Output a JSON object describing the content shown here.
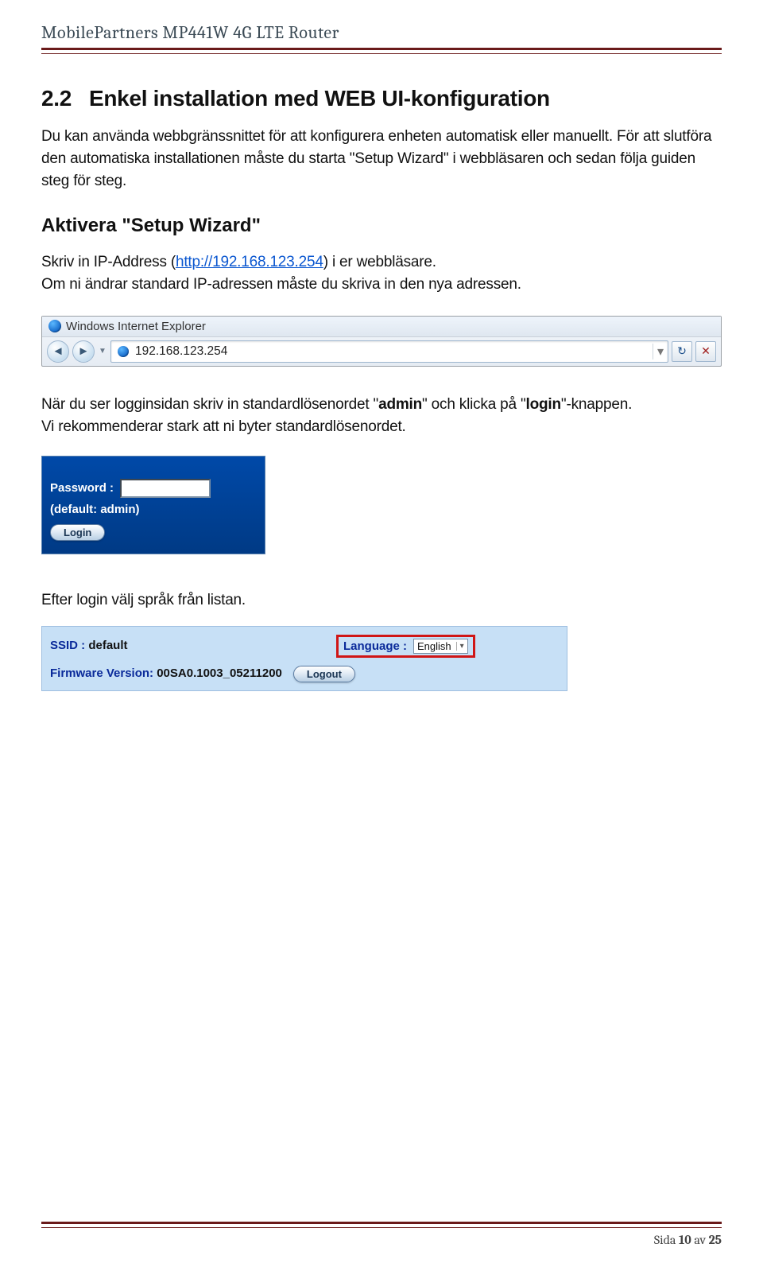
{
  "doc": {
    "header_title": "MobilePartners MP441W 4G LTE Router",
    "section_number": "2.2",
    "section_title": "Enkel installation med WEB UI-konfiguration",
    "para1": "Du kan använda webbgränssnittet för att konfigurera enheten automatisk eller manuellt. För att slutföra den automatiska installationen måste du starta \"Setup Wizard\" i webbläsaren och sedan följa guiden steg för steg.",
    "sub1": "Aktivera \"Setup Wizard\"",
    "ip_pre": "Skriv in IP-Address (",
    "ip_link_text": "http://192.168.123.254",
    "ip_post": ") i er webbläsare.",
    "ip_note": "Om ni ändrar standard IP-adressen måste du skriva in den nya adressen.",
    "para_login_a": "När du ser logginsidan skriv in standardlösenordet \"",
    "para_login_admin": "admin",
    "para_login_b": "\" och klicka på \"",
    "para_login_login": "login",
    "para_login_c": "\"-knappen.",
    "para_login_rec": "Vi rekommenderar stark att ni byter standardlösenordet.",
    "after_login": "Efter login välj språk från listan.",
    "footer_prefix": "Sida ",
    "footer_num": "10",
    "footer_mid": " av ",
    "footer_total": "25"
  },
  "ie": {
    "title": "Windows Internet Explorer",
    "url": "192.168.123.254"
  },
  "login": {
    "password_label": "Password :",
    "default_hint": "(default: admin)",
    "login_btn": "Login",
    "password_value": ""
  },
  "lang": {
    "ssid_label": "SSID : ",
    "ssid_value": "default",
    "firmware_label": "Firmware Version: ",
    "firmware_value": "00SA0.1003_05211200",
    "language_label": "Language : ",
    "language_value": "English",
    "logout_btn": "Logout"
  }
}
